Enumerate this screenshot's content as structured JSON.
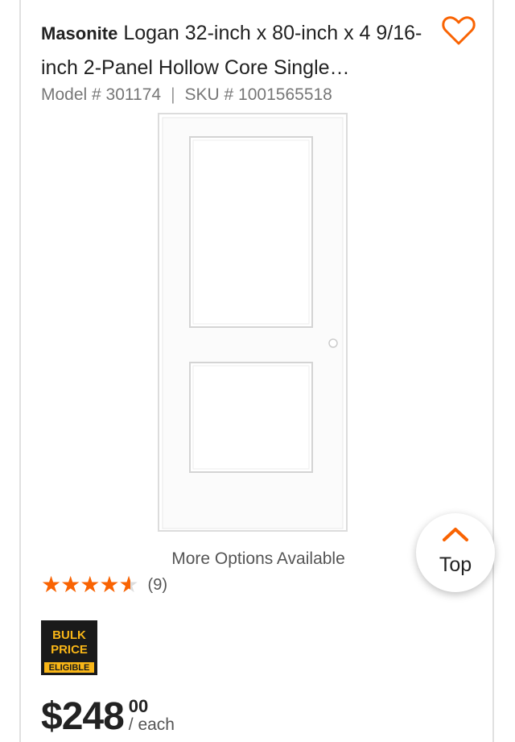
{
  "product": {
    "brand": "Masonite",
    "name": "Logan 32-inch x 80-inch x 4 9/16-inch 2-Panel Hollow Core Single…",
    "model_label": "Model # 301174",
    "sku_label": "SKU # 1001565518",
    "separator": "|",
    "more_options": "More Options Available",
    "rating": 4.6,
    "rating_count": "(9)",
    "bulk_badge": {
      "line1": "BULK",
      "line2": "PRICE",
      "line3": "ELIGIBLE"
    },
    "price_dollars": "$248",
    "price_cents": "00",
    "price_unit": "/ each"
  },
  "favorite_icon": "heart-outline-icon",
  "top_button": {
    "label": "Top",
    "icon": "chevron-up-icon"
  },
  "colors": {
    "accent": "#f96302",
    "bulk_bg": "#1a1a1a",
    "bulk_yellow": "#f9b617"
  }
}
